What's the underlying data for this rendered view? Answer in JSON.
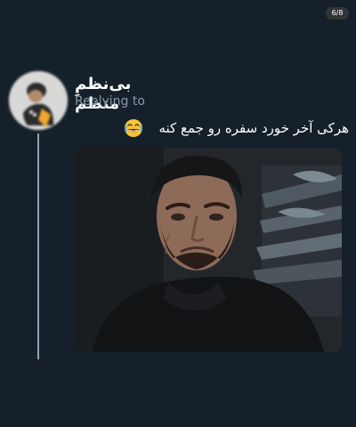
{
  "page": {
    "image_counter": "6/8"
  },
  "tweet": {
    "display_name": "بی‌نظمِ منظم",
    "replying_to": "Replying to",
    "text": "هرکی آخر خورد سفره رو جمع کنه"
  },
  "icons": {
    "emoji": "laughing-tears-emoji-icon"
  },
  "colors": {
    "background": "#15202b",
    "muted_text": "#8899a6",
    "thread_line": "#8fa7b6",
    "text": "#ffffff"
  }
}
